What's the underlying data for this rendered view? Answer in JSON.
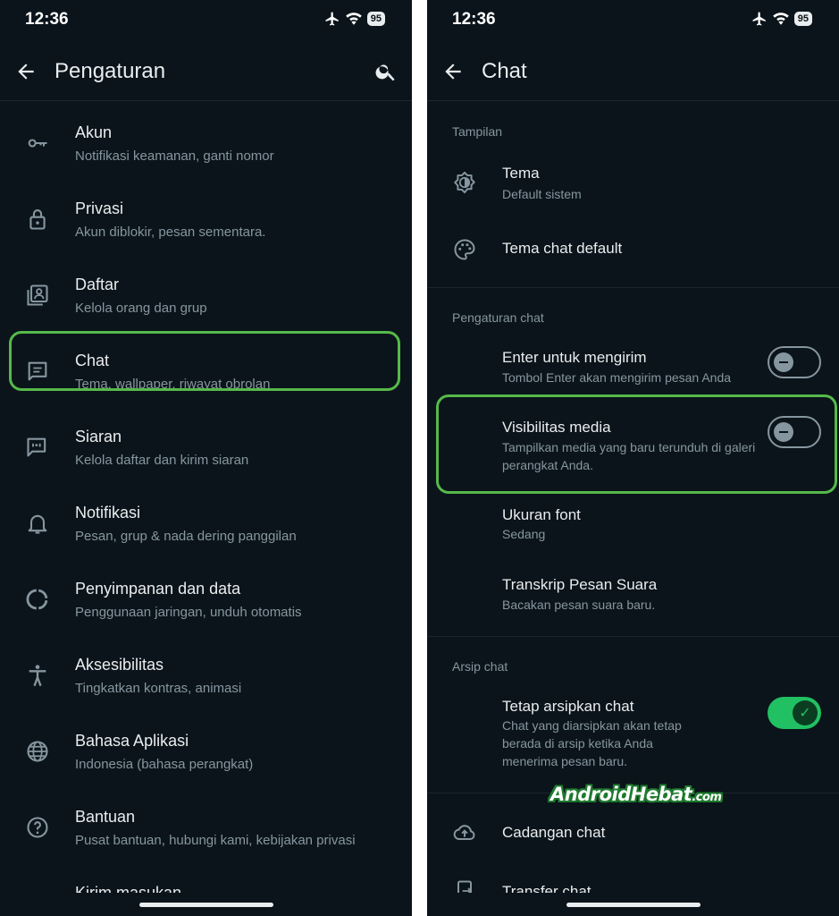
{
  "status": {
    "time": "12:36",
    "battery": "95"
  },
  "left": {
    "title": "Pengaturan",
    "items": [
      {
        "title": "Akun",
        "subtitle": "Notifikasi keamanan, ganti nomor",
        "icon": "key-icon"
      },
      {
        "title": "Privasi",
        "subtitle": "Akun diblokir, pesan sementara.",
        "icon": "lock-icon"
      },
      {
        "title": "Daftar",
        "subtitle": "Kelola orang dan grup",
        "icon": "contacts-icon"
      },
      {
        "title": "Chat",
        "subtitle": "Tema, wallpaper, riwayat obrolan",
        "icon": "chat-icon"
      },
      {
        "title": "Siaran",
        "subtitle": "Kelola daftar dan kirim siaran",
        "icon": "broadcast-icon"
      },
      {
        "title": "Notifikasi",
        "subtitle": "Pesan, grup & nada dering panggilan",
        "icon": "bell-icon"
      },
      {
        "title": "Penyimpanan dan data",
        "subtitle": "Penggunaan jaringan, unduh otomatis",
        "icon": "storage-icon"
      },
      {
        "title": "Aksesibilitas",
        "subtitle": "Tingkatkan kontras, animasi",
        "icon": "accessibility-icon"
      },
      {
        "title": "Bahasa Aplikasi",
        "subtitle": "Indonesia (bahasa perangkat)",
        "icon": "globe-icon"
      },
      {
        "title": "Bantuan",
        "subtitle": "Pusat bantuan, hubungi kami, kebijakan privasi",
        "icon": "help-icon"
      },
      {
        "title": "Kirim masukan",
        "subtitle": "",
        "icon": "bug-icon"
      }
    ]
  },
  "right": {
    "title": "Chat",
    "sections": {
      "display": "Tampilan",
      "chat_settings": "Pengaturan chat",
      "archive": "Arsip chat"
    },
    "theme": {
      "title": "Tema",
      "subtitle": "Default sistem"
    },
    "chat_theme": {
      "title": "Tema chat default"
    },
    "enter_send": {
      "title": "Enter untuk mengirim",
      "subtitle": "Tombol Enter akan mengirim pesan Anda",
      "enabled": false
    },
    "media_visibility": {
      "title": "Visibilitas media",
      "subtitle": "Tampilkan media yang baru terunduh di galeri perangkat Anda.",
      "enabled": false
    },
    "font_size": {
      "title": "Ukuran font",
      "subtitle": "Sedang"
    },
    "voice_transcript": {
      "title": "Transkrip Pesan Suara",
      "subtitle": "Bacakan pesan suara baru."
    },
    "keep_archived": {
      "title": "Tetap arsipkan chat",
      "subtitle": "Chat yang diarsipkan akan tetap berada di arsip ketika Anda menerima pesan baru.",
      "enabled": true
    },
    "backup": {
      "title": "Cadangan chat"
    },
    "transfer": {
      "title": "Transfer chat"
    }
  },
  "watermark": {
    "main": "AndroidHebat",
    "suffix": ".com"
  },
  "colors": {
    "background": "#0b141a",
    "accent": "#21c063",
    "highlight": "#55b94a",
    "secondary_text": "#8696a0"
  }
}
